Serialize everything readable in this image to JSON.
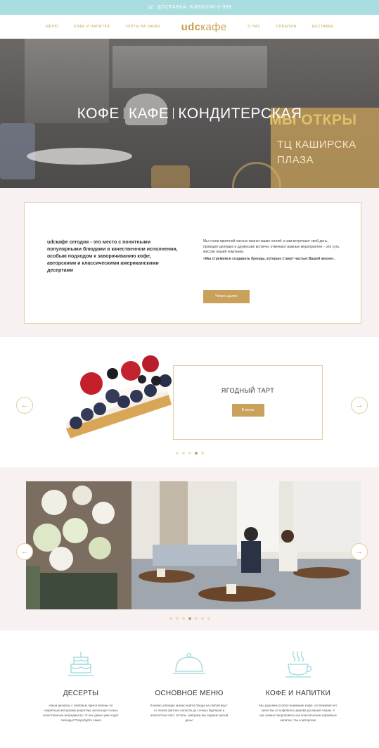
{
  "topbar": {
    "text": "ДОСТАВКА: 8(495)248-0-999"
  },
  "nav": {
    "left": [
      "Меню",
      "Кофе и напитки",
      "Торты на заказ"
    ],
    "logo_bold": "udc",
    "logo_rest": "кафе",
    "right": [
      "О нас",
      "События",
      "Доставка"
    ]
  },
  "hero": {
    "title_parts": [
      "КОФЕ",
      "КАФЕ",
      "КОНДИТЕРСКАЯ"
    ],
    "open_text": "МЫ ОТКРЫ",
    "place_line1": "ТЦ КАШИРСКА",
    "place_line2": "ПЛАЗА"
  },
  "intro": {
    "left_text": "udcкафе сегодня - это место с понятными популярными блюдами в качественном исполнении, особым подходом к заворачиванию кофе, авторскими и классическими американскими десертами",
    "right_text": "Мы стали приятной частью жизни наших гостей: к нам встречают свой день, проводят деловые и дружеские встречи, отмечают важные мероприятия – это суть миссии нашей компании.",
    "right_strong": "«Мы стремимся создавать бренды, которые станут частью Вашей жизни».",
    "button": "Читать далее"
  },
  "carousel": {
    "item_title": "ЯГОДНЫЙ ТАРТ",
    "button": "В меню",
    "prev_icon": "arrow-left-icon",
    "next_icon": "arrow-right-icon",
    "dots": 5,
    "active_dot": 3
  },
  "gallery": {
    "dots": 7,
    "active_dot": 3
  },
  "features": [
    {
      "icon": "cake-icon",
      "title": "ДЕСЕРТЫ",
      "desc": "Наши десерты с любовью приготовлены по секретным авторским рецептам, используя только качественные ингредиенты. О них давно уже ходят легенды! Попробуйте сами!"
    },
    {
      "icon": "cloche-icon",
      "title": "ОСНОВНОЕ МЕНЮ",
      "desc": "В меню udcкафе можно найти блюда на любой вкус: от легких фитнес-салатов до сочных бургеров и аппетитных паст. Кстати, завтраки мы подаем целый день!"
    },
    {
      "icon": "coffee-cup-icon",
      "title": "КОФЕ И НАПИТКИ",
      "desc": "Мы уделяем особое внимание кофе, отслеживая его качество от кофейного дерева до вашей чашки. У нас можно попробовать как классические кофейные напитки, так и авторские"
    }
  ],
  "colors": {
    "gold": "#c9a15a",
    "mint": "#a9dde0",
    "bg": "#f7f2f1"
  }
}
